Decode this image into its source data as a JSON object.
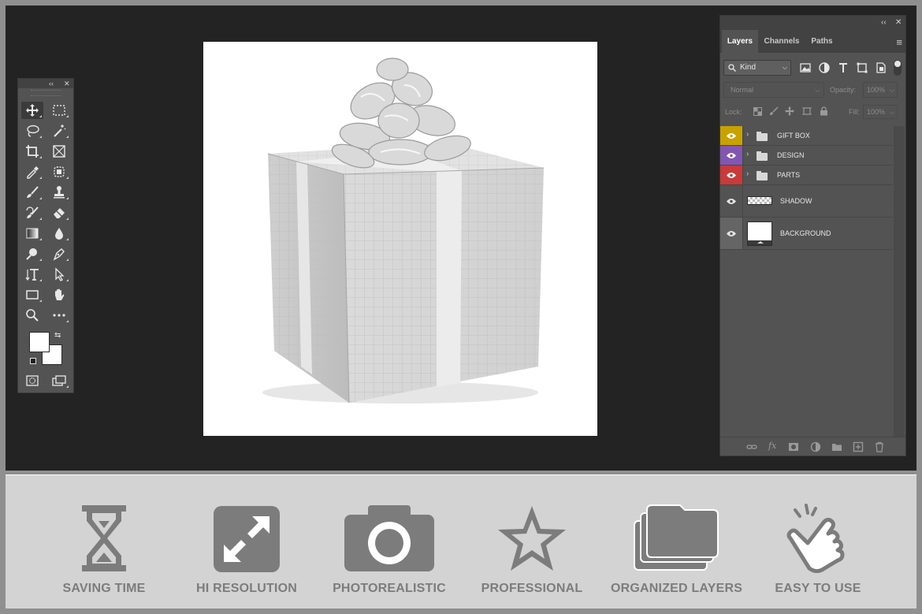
{
  "layers_panel": {
    "tabs": [
      "Layers",
      "Channels",
      "Paths"
    ],
    "active_tab": "Layers",
    "filter_kind": "Kind",
    "blend_mode": "Normal",
    "opacity_label": "Opacity:",
    "opacity_value": "100%",
    "lock_label": "Lock:",
    "fill_label": "Fill:",
    "fill_value": "100%",
    "layers": [
      {
        "name": "GIFT BOX",
        "type": "group",
        "color": "#c8a200"
      },
      {
        "name": "DESIGN",
        "type": "group",
        "color": "#8256b0"
      },
      {
        "name": "PARTS",
        "type": "group",
        "color": "#c93a3a"
      },
      {
        "name": "SHADOW",
        "type": "layer",
        "color": "#535353"
      },
      {
        "name": "BACKGROUND",
        "type": "layer",
        "color": "#656565"
      }
    ]
  },
  "toolbox": {
    "tools": [
      "move-tool",
      "marquee-tool",
      "lasso-tool",
      "magic-wand-tool",
      "crop-tool",
      "frame-tool",
      "eyedropper-tool",
      "patch-tool",
      "brush-tool",
      "stamp-tool",
      "history-brush-tool",
      "eraser-tool",
      "gradient-tool",
      "blur-tool",
      "dodge-tool",
      "pen-tool",
      "type-tool",
      "path-select-tool",
      "rectangle-tool",
      "hand-tool",
      "zoom-tool",
      "more-tools"
    ]
  },
  "features": [
    {
      "label": "SAVING TIME",
      "icon": "hourglass-icon"
    },
    {
      "label": "HI RESOLUTION",
      "icon": "expand-arrows-icon"
    },
    {
      "label": "PHOTOREALISTIC",
      "icon": "camera-icon"
    },
    {
      "label": "PROFESSIONAL",
      "icon": "star-icon"
    },
    {
      "label": "ORGANIZED LAYERS",
      "icon": "stacked-folders-icon"
    },
    {
      "label": "EASY TO USE",
      "icon": "tapping-hand-icon"
    }
  ],
  "colors": {
    "workspace": "#232323",
    "panel": "#535353",
    "feature_bar": "#d3d3d3",
    "feature_gray": "#7c7c7c"
  }
}
